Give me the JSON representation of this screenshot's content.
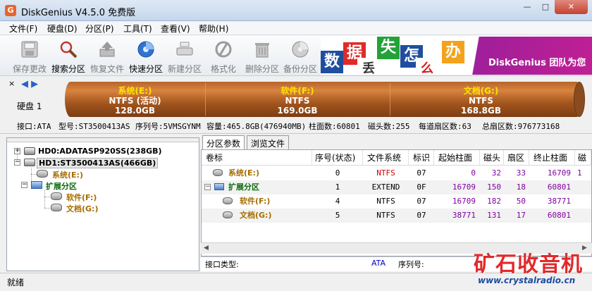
{
  "window": {
    "title": "DiskGenius V4.5.0 免费版",
    "app_icon": "G"
  },
  "menu": [
    "文件(F)",
    "硬盘(D)",
    "分区(P)",
    "工具(T)",
    "查看(V)",
    "帮助(H)"
  ],
  "toolbar": [
    {
      "label": "保存更改",
      "icon": "save-disk-icon",
      "enabled": false
    },
    {
      "label": "搜索分区",
      "icon": "magnifier-icon",
      "enabled": true
    },
    {
      "label": "恢复文件",
      "icon": "restore-icon",
      "enabled": false
    },
    {
      "label": "快速分区",
      "icon": "quick-partition-icon",
      "enabled": true
    },
    {
      "label": "新建分区",
      "icon": "new-partition-icon",
      "enabled": false
    },
    {
      "label": "格式化",
      "icon": "format-icon",
      "enabled": false
    },
    {
      "label": "删除分区",
      "icon": "trash-icon",
      "enabled": false
    },
    {
      "label": "备份分区",
      "icon": "backup-icon",
      "enabled": false
    }
  ],
  "banner": {
    "tiles": [
      "数",
      "据",
      "丢",
      "失",
      "怎",
      "么",
      "办"
    ],
    "text": "DiskGenius 团队为您"
  },
  "disk_bar": {
    "nav_close": "×",
    "nav_arrows": "◀ ▶",
    "disk_label": "硬盘 1",
    "segments": [
      {
        "name": "系统(E:)",
        "fs": "NTFS (活动)",
        "size": "128.0GB",
        "share": 0.276
      },
      {
        "name": "软件(F:)",
        "fs": "NTFS",
        "size": "169.0GB",
        "share": 0.364
      },
      {
        "name": "文档(G:)",
        "fs": "NTFS",
        "size": "168.8GB",
        "share": 0.36
      }
    ]
  },
  "disk_info": {
    "interface": "接口:ATA",
    "model": "型号:ST3500413AS",
    "serial": "序列号:5VMSGYNM",
    "capacity": "容量:465.8GB(476940MB)",
    "cylinders": "柱面数:60801",
    "heads": "磁头数:255",
    "sectors_per_track": "每道扇区数:63",
    "total_sectors": "总扇区数:976773168"
  },
  "tree": {
    "hd0": "HD0:ADATASP920SS(238GB)",
    "hd1": "HD1:ST3500413AS(466GB)",
    "sys": "系统(E:)",
    "ext": "扩展分区",
    "soft": "软件(F:)",
    "doc": "文档(G:)",
    "expand_plus": "+",
    "expand_minus": "−"
  },
  "tabs": [
    "分区参数",
    "浏览文件"
  ],
  "table": {
    "headers": [
      "卷标",
      "序号(状态)",
      "文件系统",
      "标识",
      "起始柱面",
      "磁头",
      "扇区",
      "终止柱面",
      "磁"
    ],
    "rows": [
      {
        "vol": "系统(E:)",
        "index": "0",
        "fs": "NTFS",
        "id": "07",
        "start_cyl": "0",
        "head": "32",
        "sector": "33",
        "end_cyl": "16709",
        "extra": "1"
      },
      {
        "vol": "扩展分区",
        "index": "1",
        "fs": "EXTEND",
        "id": "0F",
        "start_cyl": "16709",
        "head": "150",
        "sector": "18",
        "end_cyl": "60801",
        "extra": ""
      },
      {
        "vol": "软件(F:)",
        "index": "4",
        "fs": "NTFS",
        "id": "07",
        "start_cyl": "16709",
        "head": "182",
        "sector": "50",
        "end_cyl": "38771",
        "extra": ""
      },
      {
        "vol": "文档(G:)",
        "index": "5",
        "fs": "NTFS",
        "id": "07",
        "start_cyl": "38771",
        "head": "131",
        "sector": "17",
        "end_cyl": "60801",
        "extra": ""
      }
    ]
  },
  "detail": {
    "iface_label": "接口类型:",
    "iface_value": "ATA",
    "serial_label": "序列号:"
  },
  "status": "就绪",
  "watermark": {
    "big": "矿石收音机",
    "url": "www.crystalradio.cn"
  },
  "colors": {
    "system": "#a66d00",
    "extended": "#0a6b0a",
    "ntfs": "#d40000",
    "number": "#8000a0",
    "accent": "#2a62c8"
  }
}
